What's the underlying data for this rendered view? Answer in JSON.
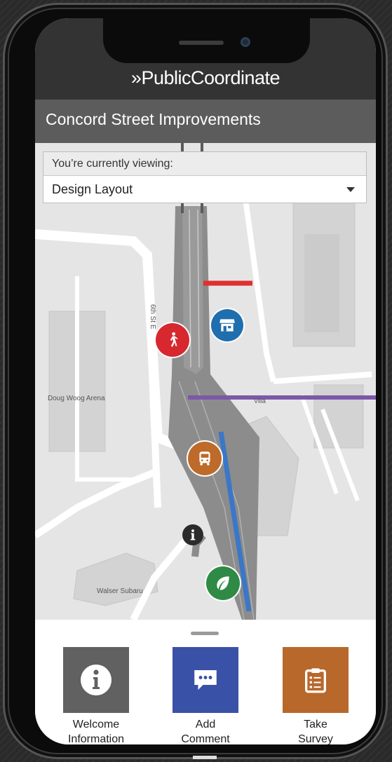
{
  "app": {
    "logo_text": "»PublicCoordinate",
    "project_title": "Concord Street Improvements"
  },
  "view_selector": {
    "label": "You’re currently viewing:",
    "selected": "Design Layout"
  },
  "map": {
    "labels": {
      "street": "6th St E",
      "arena": "Doug Woog Arena",
      "dealer": "Walser Subaru",
      "villa": "Villa"
    },
    "markers": [
      {
        "name": "pedestrian",
        "icon": "walking-person-icon",
        "color": "#d7282f"
      },
      {
        "name": "storefront",
        "icon": "storefront-icon",
        "color": "#1f6eae"
      },
      {
        "name": "transit",
        "icon": "bus-icon",
        "color": "#bd6a2a"
      },
      {
        "name": "info",
        "icon": "info-icon",
        "color": "#2b2b2b"
      },
      {
        "name": "green",
        "icon": "leaf-icon",
        "color": "#2e8a45"
      }
    ],
    "overlay_colors": {
      "red": "#e03030",
      "purple": "#7d57a8",
      "blue": "#3b77c7"
    }
  },
  "actions": [
    {
      "label_line1": "Welcome",
      "label_line2": "Information",
      "icon": "info-icon",
      "color": "#616161"
    },
    {
      "label_line1": "Add",
      "label_line2": "Comment",
      "icon": "comment-icon",
      "color": "#3a51a8"
    },
    {
      "label_line1": "Take",
      "label_line2": "Survey",
      "icon": "clipboard-icon",
      "color": "#b8682a"
    }
  ]
}
